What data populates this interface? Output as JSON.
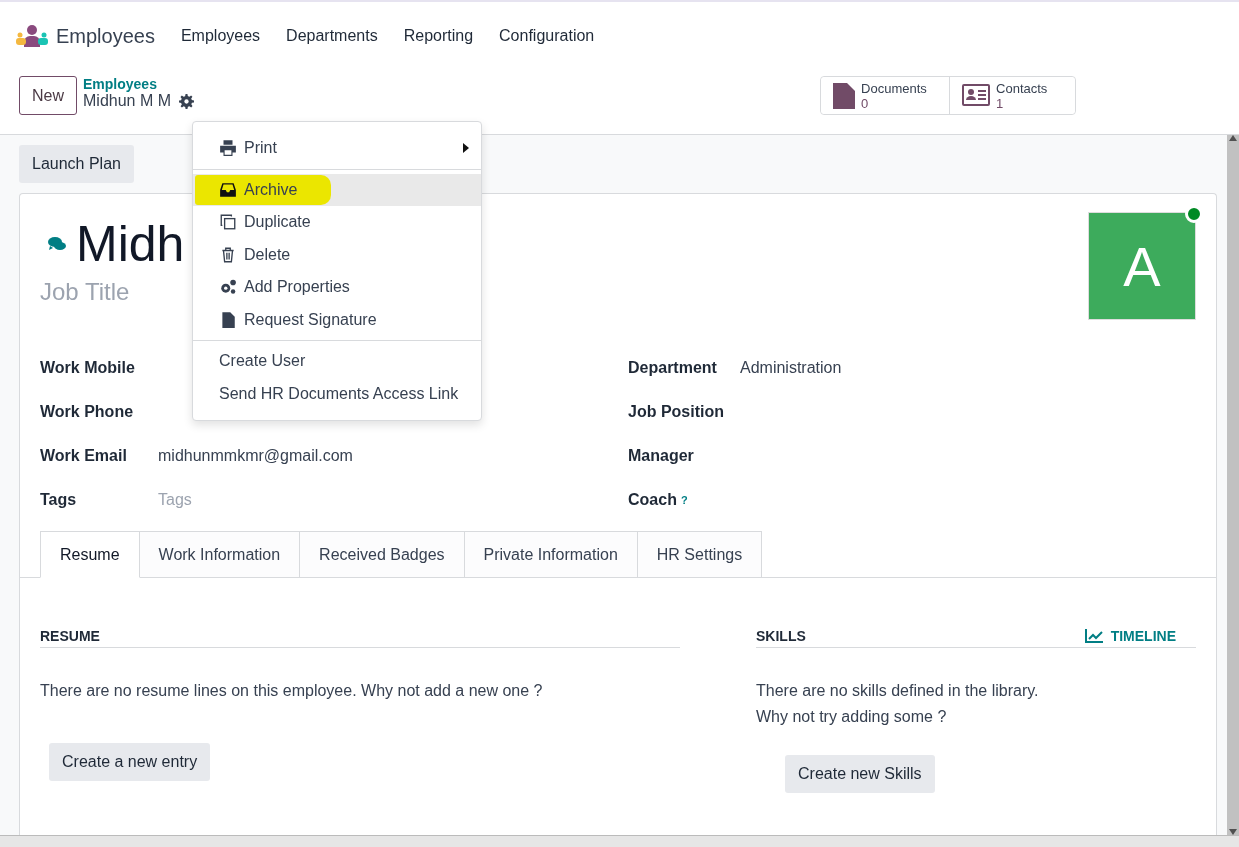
{
  "app": {
    "name": "Employees"
  },
  "nav": [
    "Employees",
    "Departments",
    "Reporting",
    "Configuration"
  ],
  "control_panel": {
    "new_button": "New",
    "breadcrumb": "Employees",
    "record": "Midhun M M"
  },
  "smart_buttons": [
    {
      "label": "Documents",
      "count": "0"
    },
    {
      "label": "Contacts",
      "count": "1"
    }
  ],
  "menu": {
    "groups": [
      [
        {
          "label": "Print",
          "submenu": true,
          "active": false
        }
      ],
      [
        {
          "label": "Archive",
          "submenu": false,
          "active": true
        },
        {
          "label": "Duplicate",
          "submenu": false,
          "active": false
        },
        {
          "label": "Delete",
          "submenu": false,
          "active": false
        },
        {
          "label": "Add Properties",
          "submenu": false,
          "active": false
        },
        {
          "label": "Request Signature",
          "submenu": false,
          "active": false
        }
      ],
      [
        {
          "label": "Create User",
          "submenu": false,
          "active": false
        },
        {
          "label": "Send HR Documents Access Link",
          "submenu": false,
          "active": false
        }
      ]
    ]
  },
  "launch_plan": "Launch Plan",
  "employee": {
    "name": "Midh",
    "job_title_placeholder": "Job Title",
    "avatar_letter": "A",
    "online": true
  },
  "fields_left": [
    {
      "label": "Work Mobile"
    },
    {
      "label": "Work Phone"
    },
    {
      "label": "Work Email",
      "value": "midhunmmkmr@gmail.com"
    },
    {
      "label": "Tags",
      "placeholder": "Tags"
    }
  ],
  "fields_right": [
    {
      "label": "Department",
      "value": "Administration"
    },
    {
      "label": "Job Position"
    },
    {
      "label": "Manager"
    },
    {
      "label": "Coach",
      "help": "?"
    }
  ],
  "tabs": [
    {
      "label": "Resume",
      "selected": true
    },
    {
      "label": "Work Information",
      "selected": false
    },
    {
      "label": "Received Badges",
      "selected": false
    },
    {
      "label": "Private Information",
      "selected": false
    },
    {
      "label": "HR Settings",
      "selected": false
    }
  ],
  "resume": {
    "title": "RESUME",
    "empty_text": "There are no resume lines on this employee. Why not add a new one ?",
    "button": "Create a new entry"
  },
  "skills": {
    "title": "SKILLS",
    "timeline": "TIMELINE",
    "empty_lines": [
      "There are no skills defined in the library.",
      "Why not try adding some ?"
    ],
    "button": "Create new Skills"
  }
}
